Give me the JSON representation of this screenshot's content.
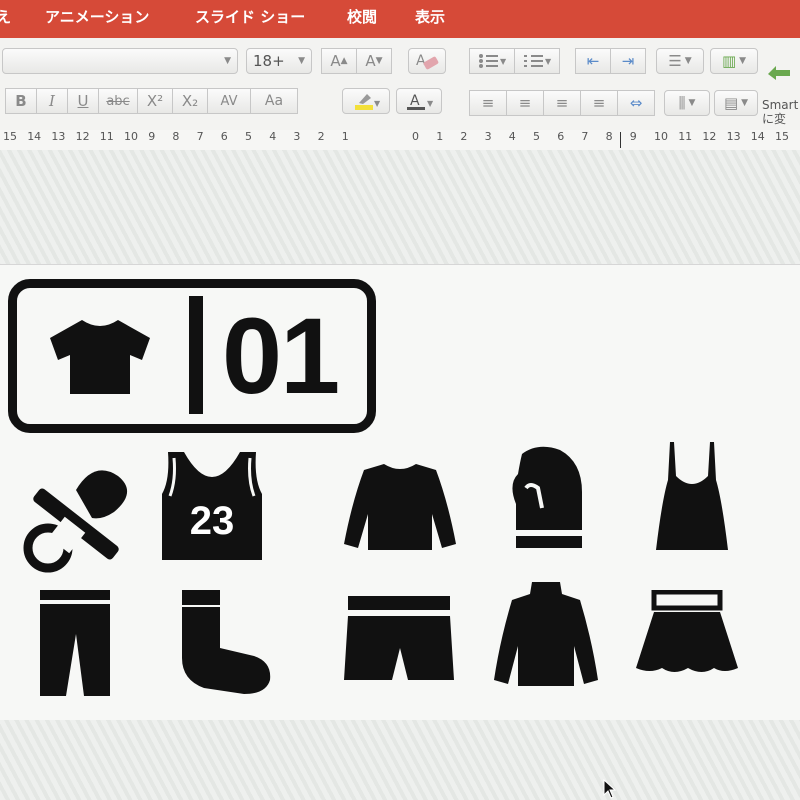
{
  "menu": {
    "items": [
      "え",
      "アニメーション",
      "スライド ショー",
      "校閲",
      "表示"
    ]
  },
  "ribbon": {
    "font_size": "18+",
    "bold": "B",
    "italic": "I",
    "underline": "U",
    "strikethrough": "abc",
    "superscript": "X²",
    "subscript": "X₂",
    "spacing": "AV",
    "change_case": "Aa",
    "smartart_line1": "Smart",
    "smartart_line2": "に変"
  },
  "ruler": {
    "left_ticks": [
      "15",
      "14",
      "13",
      "12",
      "11",
      "10",
      "9",
      "8",
      "7",
      "6",
      "5",
      "4",
      "3",
      "2",
      "1"
    ],
    "right_ticks": [
      "0",
      "1",
      "2",
      "3",
      "4",
      "5",
      "6",
      "7",
      "8",
      "9",
      "10",
      "11",
      "12",
      "13",
      "14",
      "15"
    ]
  },
  "slide": {
    "label_number": "01",
    "jersey_number": "23",
    "icons": [
      "t-shirt-icon",
      "pacifier-icon",
      "basketball-jersey-icon",
      "long-sleeve-shirt-icon",
      "mitten-icon",
      "camisole-icon",
      "pants-icon",
      "sock-icon",
      "shorts-icon",
      "turtleneck-icon",
      "skirt-icon"
    ]
  },
  "colors": {
    "menu_bar": "#d64a38",
    "icon_fill": "#111111",
    "slide_background": "#f7f8f6"
  }
}
